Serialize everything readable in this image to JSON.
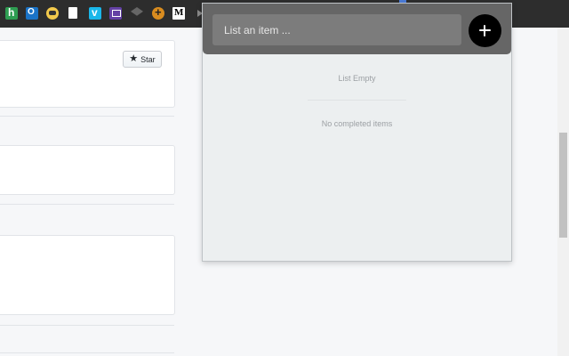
{
  "bookmarks": [
    {
      "icon": "houzz-icon"
    },
    {
      "icon": "outlook-icon"
    },
    {
      "icon": "weather-icon"
    },
    {
      "icon": "document-icon"
    },
    {
      "icon": "vimeo-icon"
    },
    {
      "icon": "twitch-icon"
    },
    {
      "icon": "graduation-cap-icon"
    },
    {
      "icon": "globe-icon"
    },
    {
      "icon": "medium-icon"
    },
    {
      "icon": "more-arrow-icon"
    }
  ],
  "page": {
    "star_label": "Star"
  },
  "popup": {
    "input_placeholder": "List an item ...",
    "input_value": "",
    "add_button_icon": "plus-icon",
    "empty_message": "List Empty",
    "completed_message": "No completed items"
  },
  "colors": {
    "popup_header": "#666666",
    "popup_body": "#eceff0",
    "add_button": "#000000",
    "input_background": "#7c7c7c"
  }
}
